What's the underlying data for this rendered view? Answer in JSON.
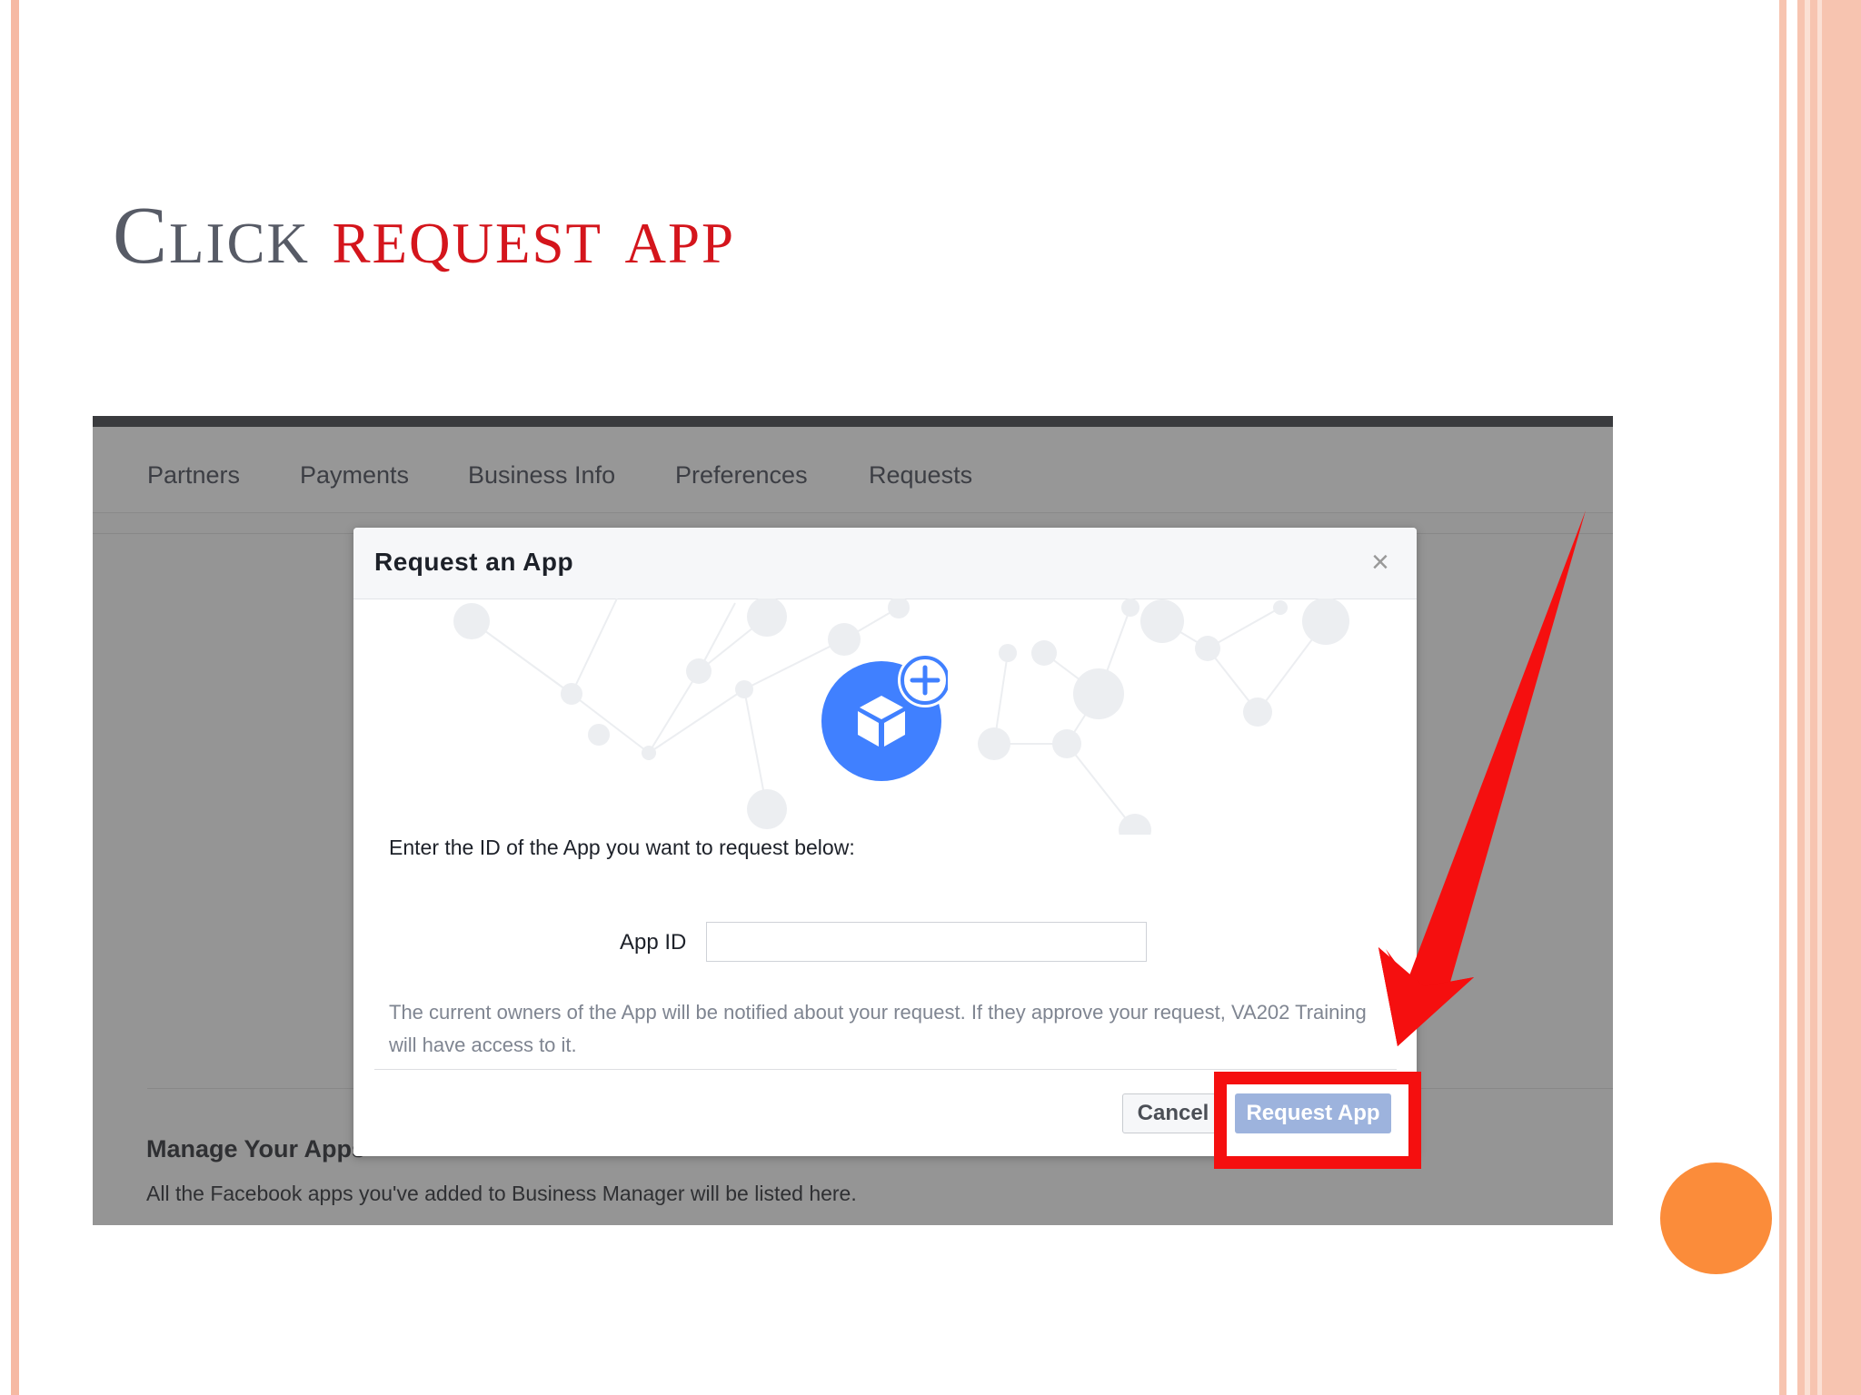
{
  "slide": {
    "title_word": "Click",
    "title_rest": "request app"
  },
  "screenshot": {
    "tabs": [
      "Partners",
      "Payments",
      "Business Info",
      "Preferences",
      "Requests"
    ],
    "manage_heading": "Manage Your Apps",
    "manage_description": "All the Facebook apps you've added to Business Manager will be listed here."
  },
  "modal": {
    "title": "Request an App",
    "close_glyph": "×",
    "prompt": "Enter the ID of the App you want to request below:",
    "app_id_label": "App ID",
    "app_id_value": "",
    "note": "The current owners of the App will be notified about your request. If they approve your request, VA202 Training will have access to it.",
    "cancel_label": "Cancel",
    "request_label": "Request App"
  },
  "icons": {
    "app": "cube-icon",
    "add": "plus-icon",
    "close": "close-icon"
  },
  "colors": {
    "title_gray": "#575b66",
    "title_red": "#d4151c",
    "facebook_blue": "#4080ff",
    "request_button": "#9db3dd",
    "highlight_red": "#f50f0f",
    "accent_orange": "#fb8c3a",
    "border_peach": "#f7c4b0"
  }
}
